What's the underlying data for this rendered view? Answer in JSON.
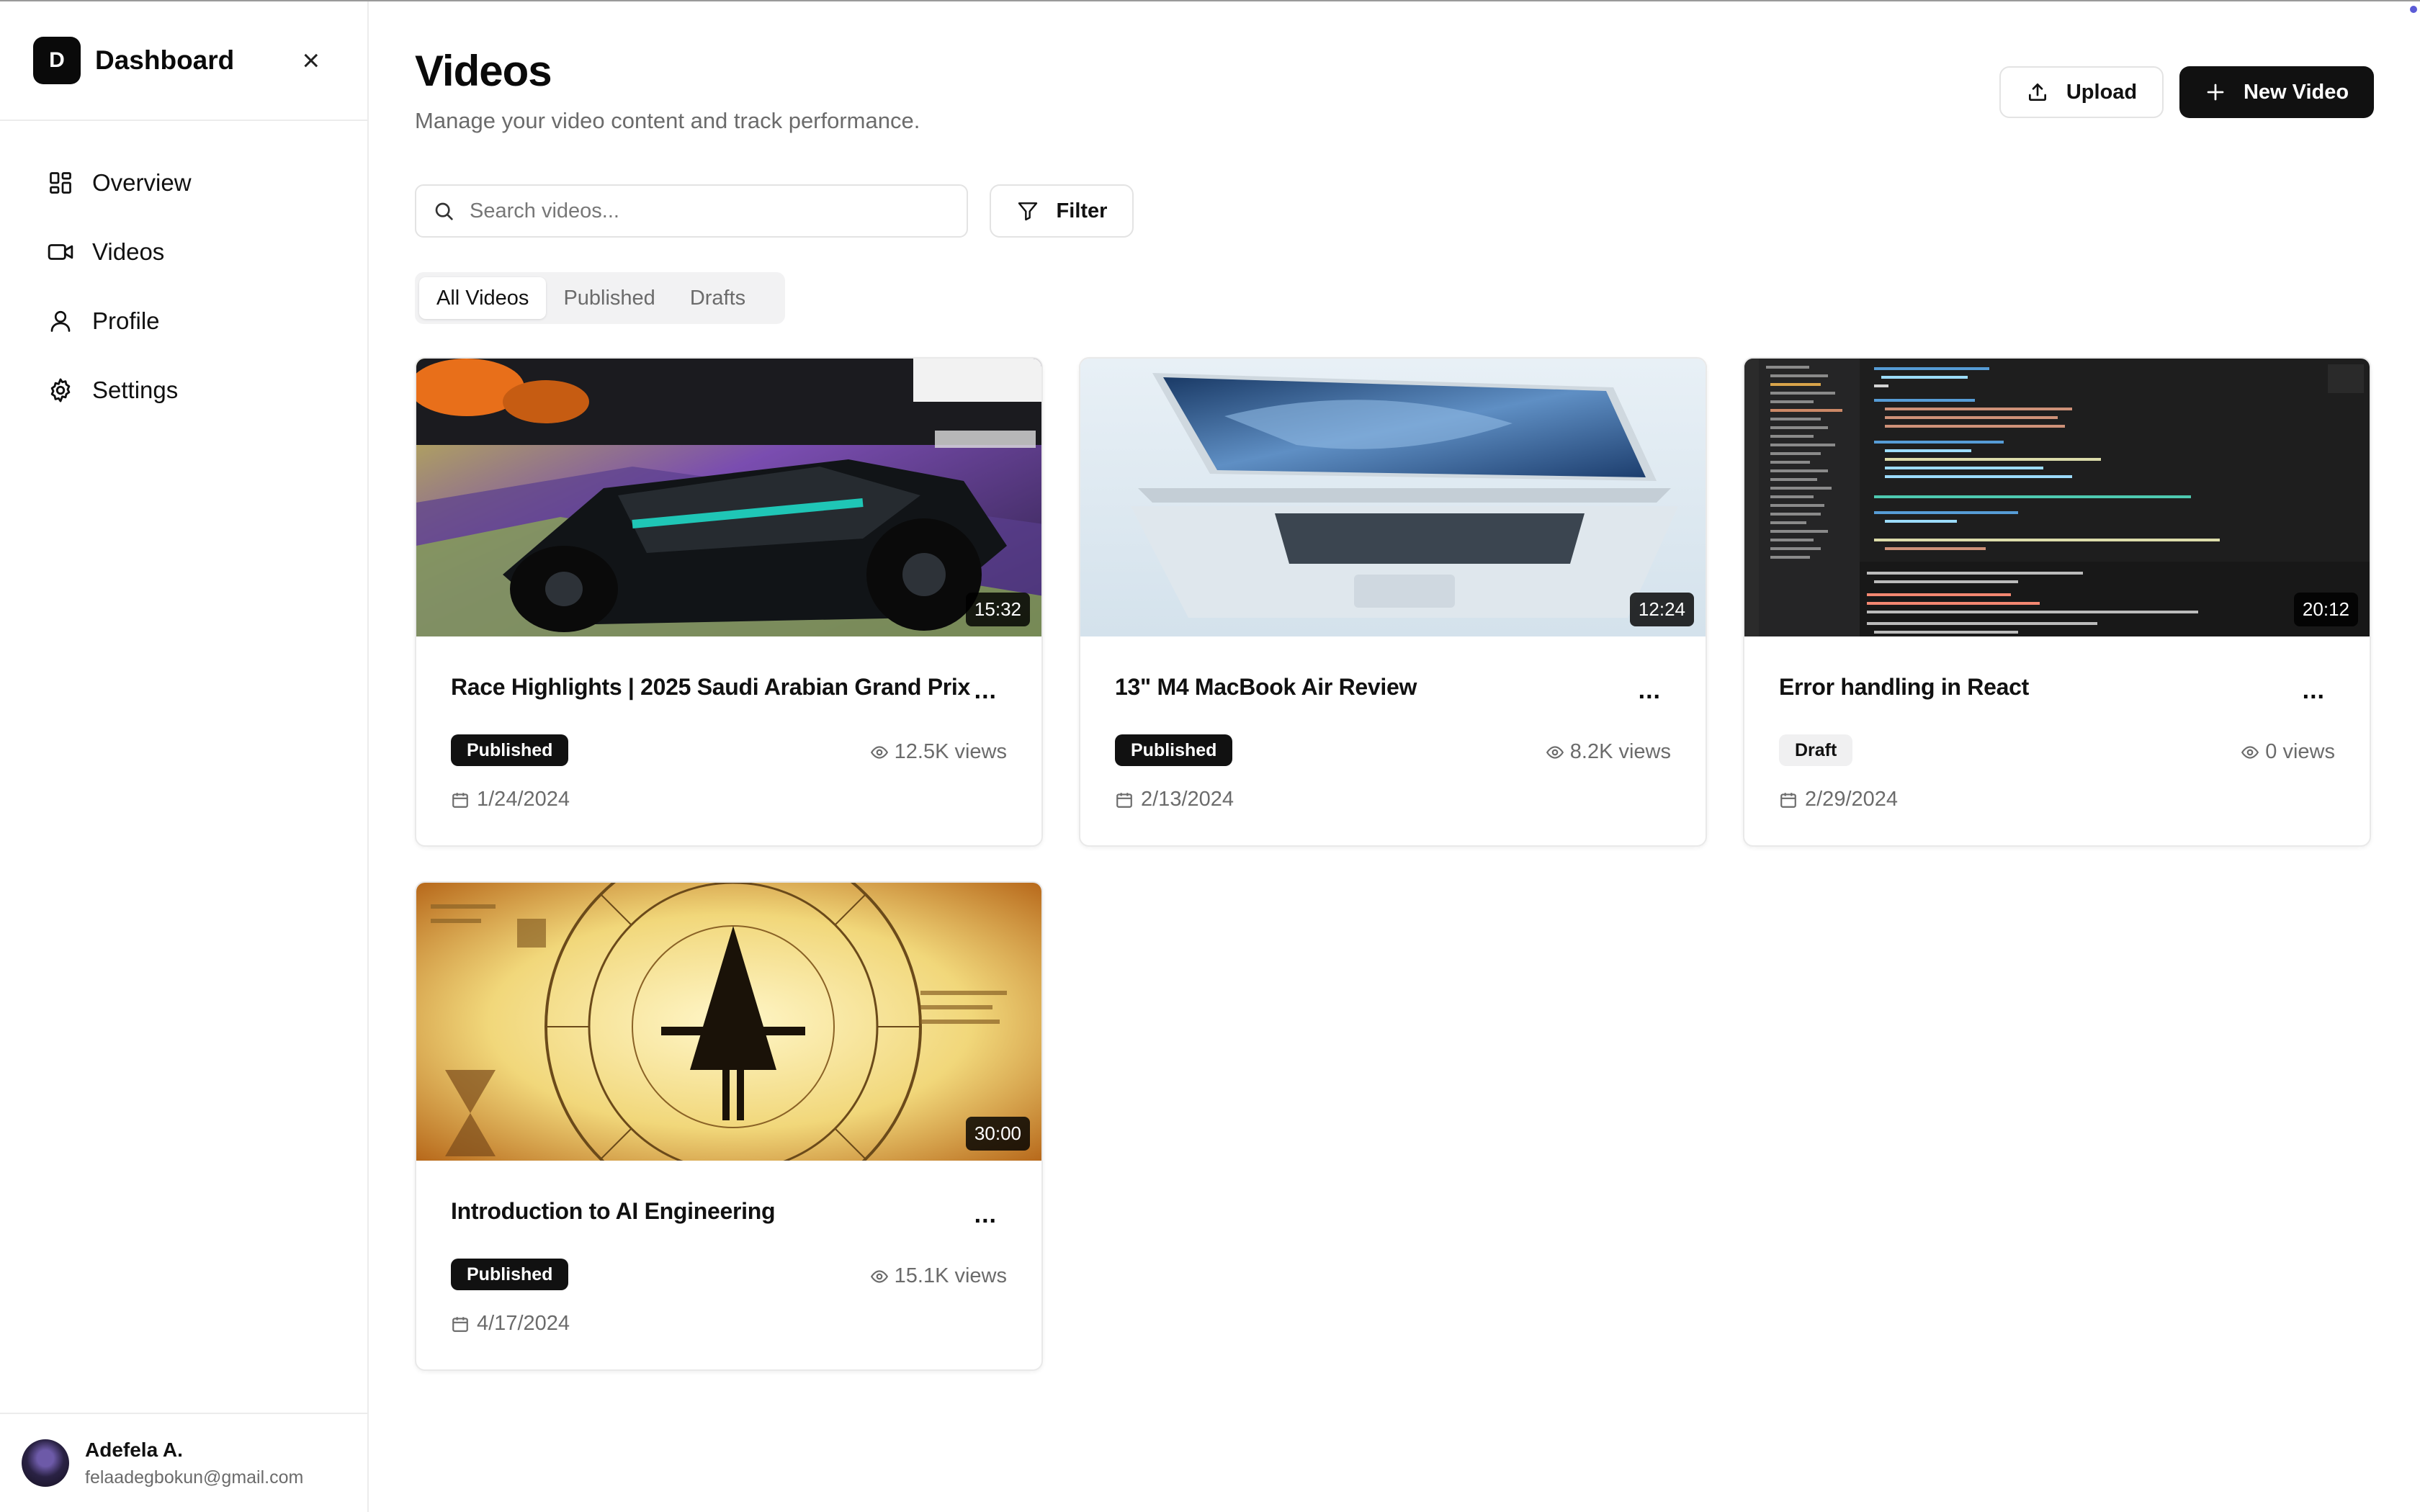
{
  "sidebar": {
    "logo_letter": "D",
    "title": "Dashboard",
    "close_glyph": "×",
    "items": [
      {
        "label": "Overview",
        "icon": "layout-grid-icon"
      },
      {
        "label": "Videos",
        "icon": "video-camera-icon"
      },
      {
        "label": "Profile",
        "icon": "user-icon"
      },
      {
        "label": "Settings",
        "icon": "gear-icon"
      }
    ],
    "user": {
      "name": "Adefela A.",
      "email": "felaadegbokun@gmail.com"
    }
  },
  "header": {
    "title": "Videos",
    "subtitle": "Manage your video content and track performance.",
    "upload_label": "Upload",
    "new_video_label": "New Video"
  },
  "toolbar": {
    "search_placeholder": "Search videos...",
    "filter_label": "Filter"
  },
  "tabs": [
    {
      "label": "All Videos",
      "active": true
    },
    {
      "label": "Published",
      "active": false
    },
    {
      "label": "Drafts",
      "active": false
    }
  ],
  "videos": [
    {
      "title": "Race Highlights | 2025 Saudi Arabian Grand Prix",
      "duration": "15:32",
      "status": "Published",
      "views": "12.5K views",
      "date": "1/24/2024",
      "thumbnail": "f1-race-car"
    },
    {
      "title": "13\" M4 MacBook Air Review",
      "duration": "12:24",
      "status": "Published",
      "views": "8.2K views",
      "date": "2/13/2024",
      "thumbnail": "macbook-air"
    },
    {
      "title": "Error handling in React",
      "duration": "20:12",
      "status": "Draft",
      "views": "0 views",
      "date": "2/29/2024",
      "thumbnail": "code-editor"
    },
    {
      "title": "Introduction to AI Engineering",
      "duration": "30:00",
      "status": "Published",
      "views": "15.1K views",
      "date": "4/17/2024",
      "thumbnail": "cipher-wheel"
    }
  ],
  "more_glyph": "...",
  "colors": {
    "primary": "#111111",
    "muted": "#6b6b6b",
    "border": "#e9e9e9",
    "tab_bg": "#f2f2f3"
  }
}
